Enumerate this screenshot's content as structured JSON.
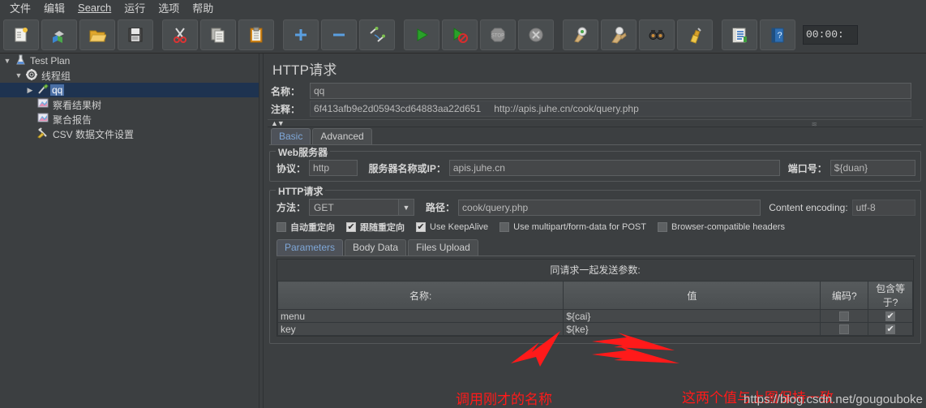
{
  "menubar": {
    "items": [
      {
        "label": "文件",
        "name": "menu-file"
      },
      {
        "label": "编辑",
        "name": "menu-edit"
      },
      {
        "label": "Search",
        "name": "menu-search"
      },
      {
        "label": "运行",
        "name": "menu-run"
      },
      {
        "label": "选项",
        "name": "menu-options"
      },
      {
        "label": "帮助",
        "name": "menu-help"
      }
    ]
  },
  "toolbar": {
    "buttons": [
      {
        "icon": "new-icon",
        "glyph": "📋"
      },
      {
        "icon": "templates-icon",
        "glyph": "📚"
      },
      {
        "icon": "open-icon",
        "glyph": "📂"
      },
      {
        "icon": "save-icon",
        "glyph": "💾"
      },
      {
        "icon": "cut-icon",
        "glyph": "✂"
      },
      {
        "icon": "copy-icon",
        "glyph": "❐"
      },
      {
        "icon": "paste-icon",
        "glyph": "📋"
      },
      {
        "icon": "expand-icon",
        "glyph": "+"
      },
      {
        "icon": "collapse-icon",
        "glyph": "−"
      },
      {
        "icon": "toggle-icon",
        "glyph": "🖉"
      },
      {
        "icon": "start-icon",
        "glyph": "▶"
      },
      {
        "icon": "start-no-pauses-icon",
        "glyph": "▶"
      },
      {
        "icon": "stop-icon",
        "glyph": "STOP"
      },
      {
        "icon": "shutdown-icon",
        "glyph": "✖"
      },
      {
        "icon": "clear-icon",
        "glyph": "🧹"
      },
      {
        "icon": "clear-all-icon",
        "glyph": "🧹"
      },
      {
        "icon": "search-icon",
        "glyph": "🔭"
      },
      {
        "icon": "reset-search-icon",
        "glyph": "🧹"
      },
      {
        "icon": "function-helper-icon",
        "glyph": "📘"
      },
      {
        "icon": "help-icon",
        "glyph": "❓"
      }
    ],
    "timer": "00:00:"
  },
  "tree": {
    "nodes": [
      {
        "label": "Test Plan",
        "icon": "test-plan-icon",
        "glyph": "🝊",
        "indent": 0,
        "toggle": "▼",
        "selected": false,
        "highlight": false
      },
      {
        "label": "线程组",
        "icon": "thread-group-icon",
        "glyph": "⚙",
        "indent": 1,
        "toggle": "▼",
        "selected": false,
        "highlight": false
      },
      {
        "label": "qq",
        "icon": "http-request-icon",
        "glyph": "🖉",
        "indent": 2,
        "toggle": "▶",
        "selected": true,
        "highlight": true
      },
      {
        "label": "察看结果树",
        "icon": "view-results-tree-icon",
        "glyph": "📈",
        "indent": 2,
        "toggle": "",
        "selected": false,
        "highlight": false
      },
      {
        "label": "聚合报告",
        "icon": "aggregate-report-icon",
        "glyph": "📈",
        "indent": 2,
        "toggle": "",
        "selected": false,
        "highlight": false
      },
      {
        "label": "CSV 数据文件设置",
        "icon": "csv-data-set-icon",
        "glyph": "🛠",
        "indent": 2,
        "toggle": "",
        "selected": false,
        "highlight": false
      }
    ]
  },
  "panel": {
    "title": "HTTP请求",
    "name_label": "名称：",
    "name_value": "qq",
    "comments_label": "注释：",
    "comments_value": "6f413afb9e2d05943cd64883aa22d651",
    "comments_value2": "http://apis.juhe.cn/cook/query.php",
    "tabs": [
      {
        "label": "Basic",
        "name": "tab-basic",
        "active": true
      },
      {
        "label": "Advanced",
        "name": "tab-advanced",
        "active": false
      }
    ],
    "webserver": {
      "group_label": "Web服务器",
      "protocol_label": "协议：",
      "protocol_value": "http",
      "server_label": "服务器名称或IP：",
      "server_value": "apis.juhe.cn",
      "port_label": "端口号：",
      "port_value": "${duan}"
    },
    "httprequest": {
      "group_label": "HTTP请求",
      "method_label": "方法：",
      "method_value": "GET",
      "path_label": "路径：",
      "path_value": "cook/query.php",
      "encoding_label": "Content encoding:",
      "encoding_value": "utf-8"
    },
    "checkboxes": [
      {
        "label": "自动重定向",
        "checked": false,
        "bold": true,
        "name": "checkbox-auto-redirect"
      },
      {
        "label": "跟随重定向",
        "checked": true,
        "bold": true,
        "name": "checkbox-follow-redirect"
      },
      {
        "label": "Use KeepAlive",
        "checked": true,
        "bold": false,
        "name": "checkbox-use-keepalive"
      },
      {
        "label": "Use multipart/form-data for POST",
        "checked": false,
        "bold": false,
        "name": "checkbox-use-multipart"
      },
      {
        "label": "Browser-compatible headers",
        "checked": false,
        "bold": false,
        "name": "checkbox-browser-compatible-headers"
      }
    ],
    "param_tabs": [
      {
        "label": "Parameters",
        "name": "tab-parameters",
        "active": true
      },
      {
        "label": "Body Data",
        "name": "tab-body-data",
        "active": false
      },
      {
        "label": "Files Upload",
        "name": "tab-files-upload",
        "active": false
      }
    ],
    "params": {
      "caption": "同请求一起发送参数:",
      "columns": [
        "名称:",
        "值",
        "编码?",
        "包含等于?"
      ],
      "rows": [
        {
          "name": "menu",
          "value": "${cai}",
          "encode": false,
          "include_equals": true
        },
        {
          "name": "key",
          "value": "${ke}",
          "encode": false,
          "include_equals": true
        }
      ]
    }
  },
  "annotations": {
    "note_left": "调用刚才的名称",
    "note_right": "这两个值与上图保持一致",
    "watermark": "https://blog.csdn.net/gougouboke",
    "arrow_color": "#ff1a1a"
  }
}
